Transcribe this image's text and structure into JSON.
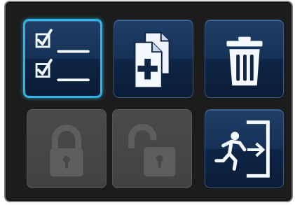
{
  "toolbar": {
    "tiles": [
      {
        "name": "checklist",
        "icon": "checklist-icon",
        "state": "selected"
      },
      {
        "name": "copy-add",
        "icon": "copy-add-icon",
        "state": "enabled"
      },
      {
        "name": "delete",
        "icon": "trash-icon",
        "state": "enabled"
      },
      {
        "name": "lock",
        "icon": "lock-closed-icon",
        "state": "disabled"
      },
      {
        "name": "unlock",
        "icon": "lock-open-icon",
        "state": "disabled"
      },
      {
        "name": "exit",
        "icon": "exit-door-icon",
        "state": "enabled"
      }
    ]
  },
  "colors": {
    "panel": "#1c1c1c",
    "tile_active": "#153156",
    "tile_disabled": "#474747",
    "selection_glow": "#2fb4e6",
    "icon_active": "#f4f8ff",
    "icon_disabled": "#5e5e5e"
  }
}
